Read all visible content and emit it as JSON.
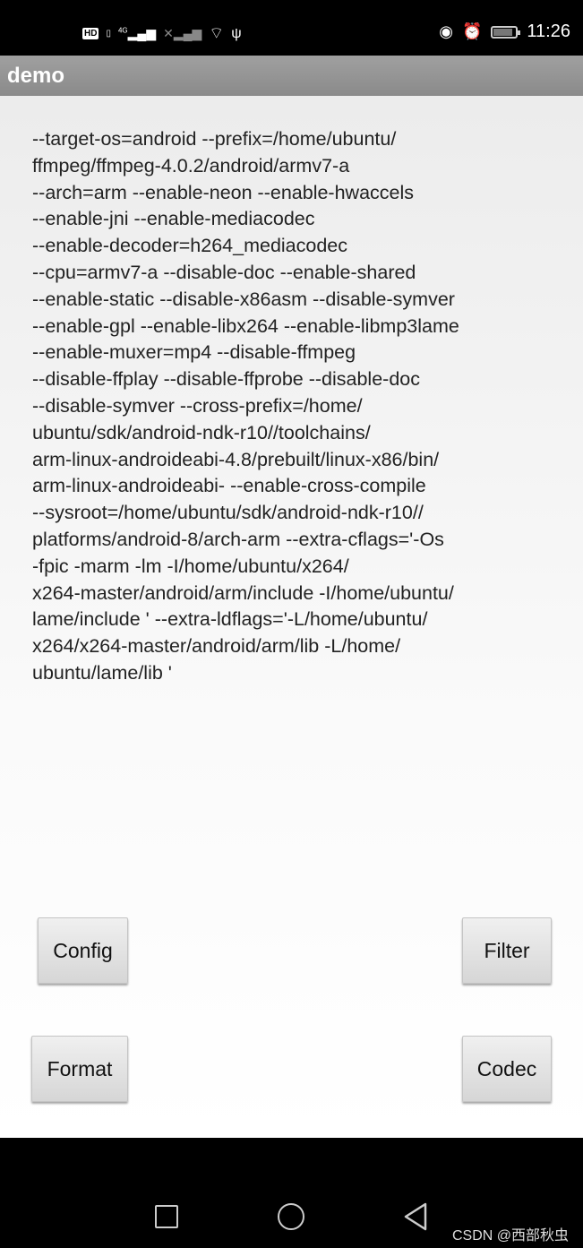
{
  "status_bar": {
    "left_icons": [
      "hd-icon",
      "sim-icon",
      "4g-signal-icon",
      "no-signal-icon",
      "wifi-icon",
      "usb-icon"
    ],
    "network_label": "4G",
    "hd_label": "HD",
    "right_icons": [
      "eye-comfort-icon",
      "alarm-icon",
      "battery-charging-icon"
    ],
    "time": "11:26"
  },
  "app_bar": {
    "title": "demo"
  },
  "main": {
    "config_lines": [
      "--target-os=android --prefix=/home/ubuntu/",
      "ffmpeg/ffmpeg-4.0.2/android/armv7-a",
      "--arch=arm --enable-neon --enable-hwaccels",
      "--enable-jni --enable-mediacodec",
      "--enable-decoder=h264_mediacodec",
      "--cpu=armv7-a --disable-doc --enable-shared",
      "--enable-static --disable-x86asm --disable-symver",
      "--enable-gpl --enable-libx264 --enable-libmp3lame",
      "--enable-muxer=mp4 --disable-ffmpeg",
      "--disable-ffplay --disable-ffprobe --disable-doc",
      "--disable-symver --cross-prefix=/home/",
      "ubuntu/sdk/android-ndk-r10//toolchains/",
      "arm-linux-androideabi-4.8/prebuilt/linux-x86/bin/",
      "arm-linux-androideabi- --enable-cross-compile",
      "--sysroot=/home/ubuntu/sdk/android-ndk-r10//",
      "platforms/android-8/arch-arm --extra-cflags='-Os",
      "-fpic -marm -lm -I/home/ubuntu/x264/",
      "x264-master/android/arm/include -I/home/ubuntu/",
      "lame/include ' --extra-ldflags='-L/home/ubuntu/",
      "x264/x264-master/android/arm/lib -L/home/",
      "ubuntu/lame/lib '"
    ],
    "buttons": {
      "config": "Config",
      "filter": "Filter",
      "format": "Format",
      "codec": "Codec"
    }
  },
  "nav_bar": {
    "icons": [
      "recents-icon",
      "home-icon",
      "back-icon"
    ]
  },
  "watermark": "CSDN @西部秋虫"
}
